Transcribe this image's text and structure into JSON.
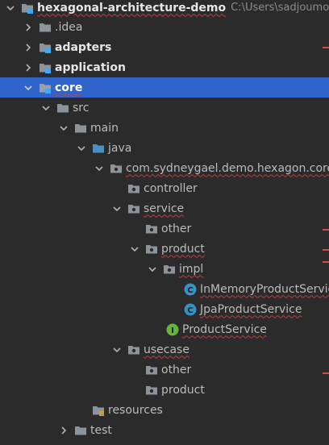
{
  "root": {
    "label": "hexagonal-architecture-demo",
    "path": "C:\\Users\\sadjoumour"
  },
  "items": {
    "idea": ".idea",
    "adapters": "adapters",
    "application": "application",
    "core": "core",
    "src": "src",
    "main": "main",
    "java": "java",
    "package": "com.sydneygael.demo.hexagon.core",
    "controller": "controller",
    "service": "service",
    "service_other": "other",
    "product": "product",
    "impl": "impl",
    "inmemory": "InMemoryProductService",
    "jpa": "JpaProductService",
    "productservice": "ProductService",
    "usecase": "usecase",
    "usecase_other": "other",
    "usecase_product": "product",
    "resources": "resources",
    "test": "test"
  },
  "icons": {
    "class_letter": "C",
    "interface_letter": "I"
  },
  "colors": {
    "background": "#2b2b2b",
    "selection": "#2f65ca",
    "folder": "#8d939a",
    "source_folder": "#4a90c4",
    "module_badge": "#3fa9f5",
    "class_icon": "#3592c4",
    "interface_icon": "#62b543",
    "error_underline": "#bc3f3c"
  }
}
